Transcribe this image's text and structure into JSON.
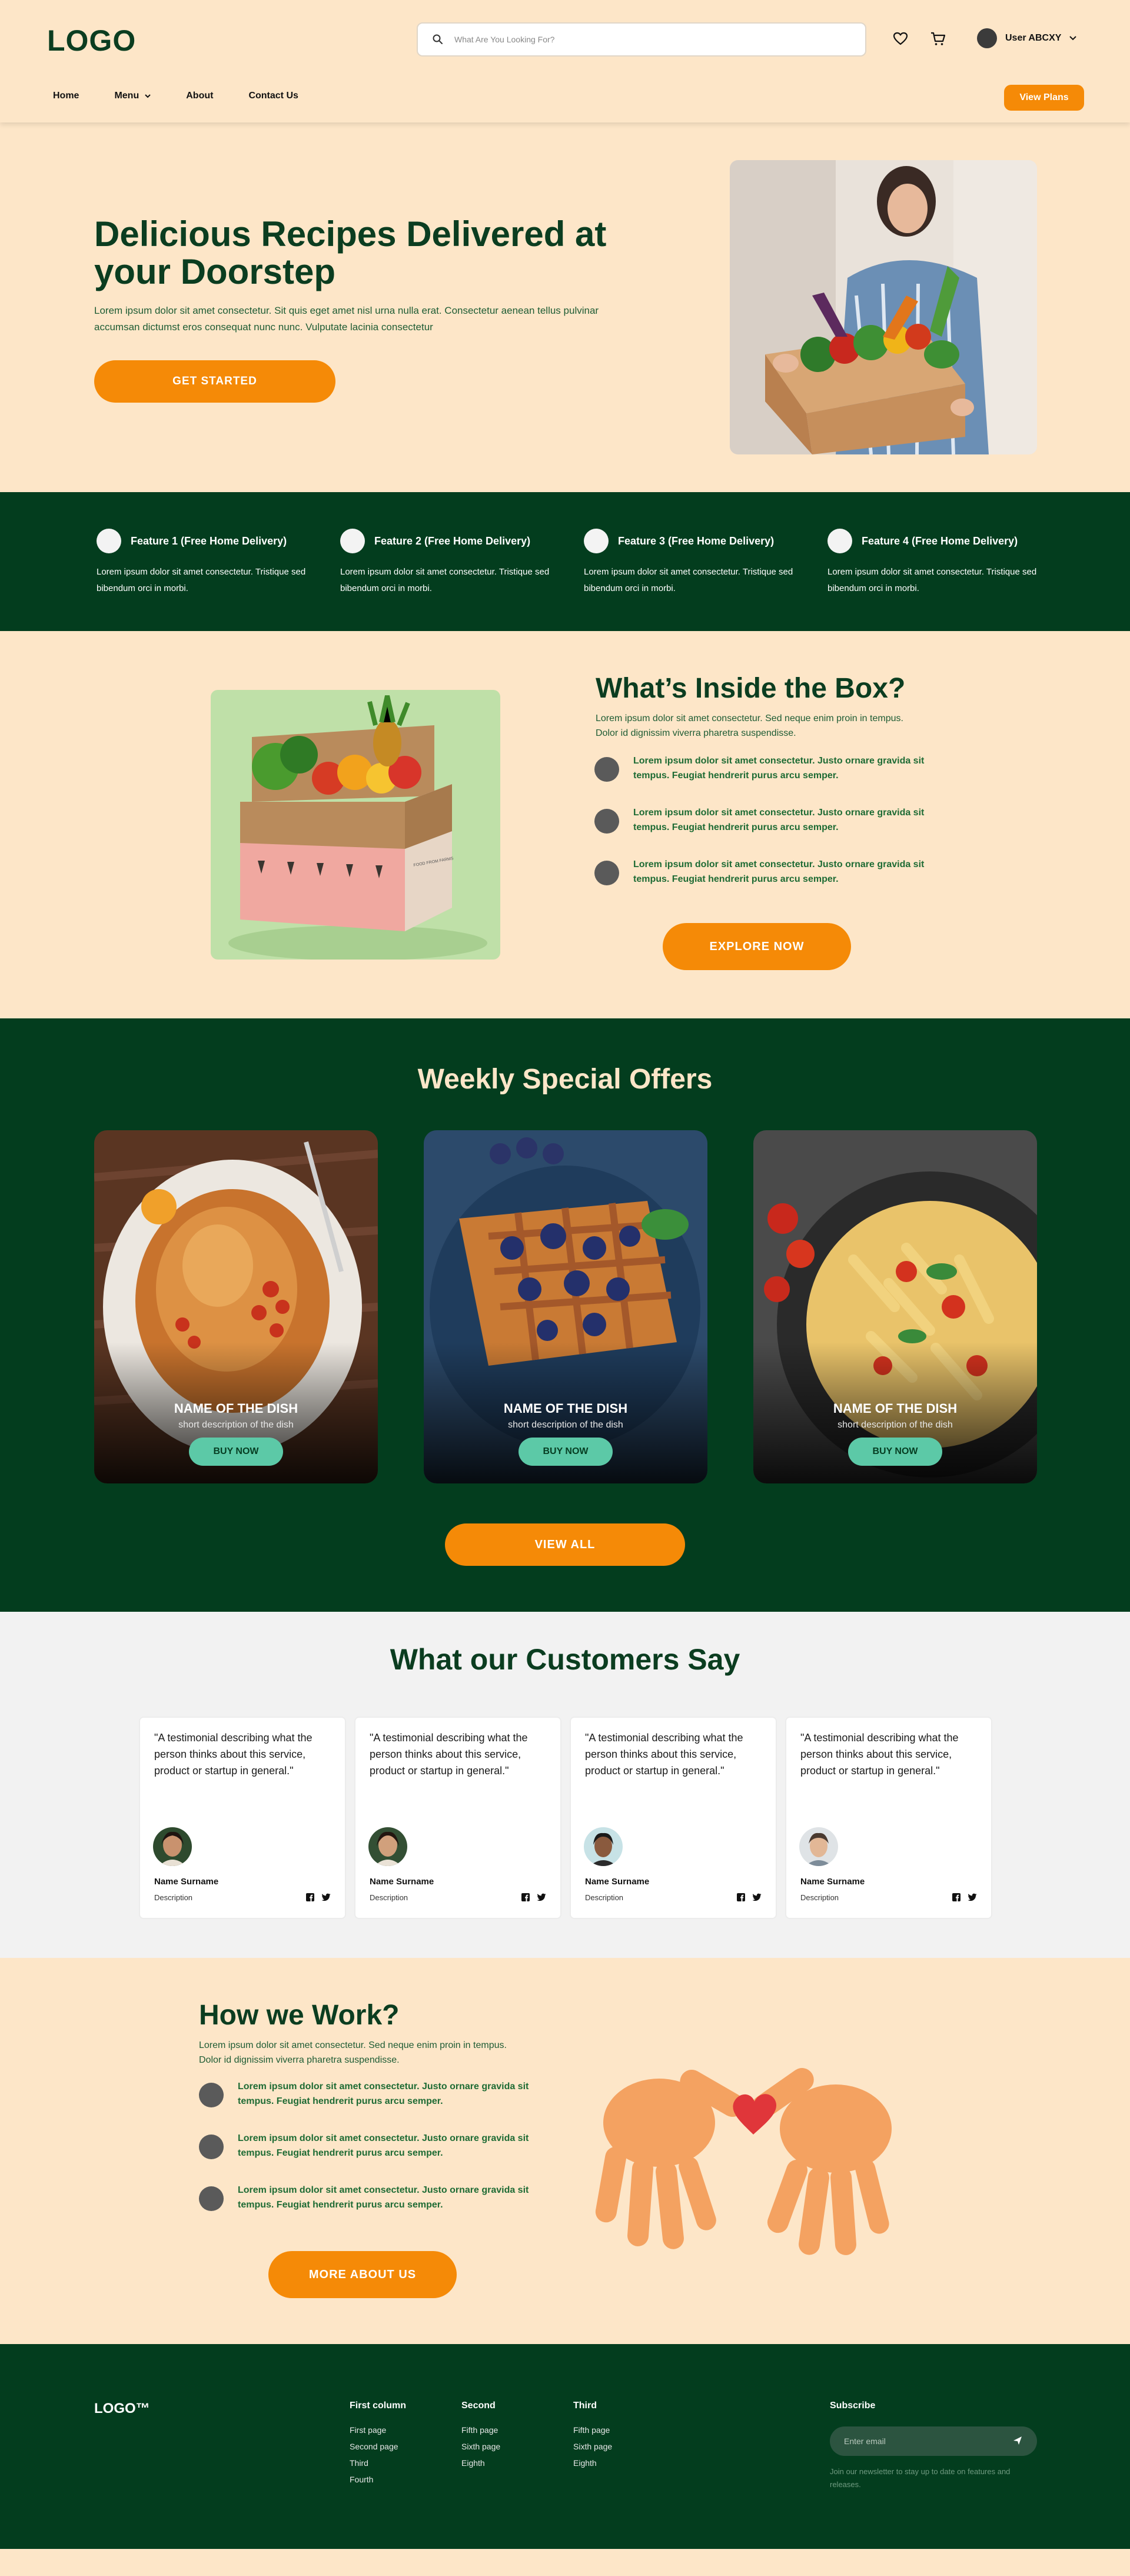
{
  "header": {
    "logo": "LOGO",
    "search_placeholder": "What Are You Looking For?",
    "user_name": "User ABCXY",
    "nav": [
      "Home",
      "Menu",
      "About",
      "Contact Us"
    ],
    "view_plans": "View Plans"
  },
  "hero": {
    "title": "Delicious Recipes Delivered at your Doorstep",
    "text": "Lorem ipsum dolor sit amet consectetur. Sit quis eget amet nisl urna nulla erat. Consectetur aenean tellus pulvinar accumsan dictumst eros consequat nunc nunc. Vulputate lacinia consectetur",
    "cta": "GET STARTED"
  },
  "features": [
    {
      "title": "Feature 1 (Free Home Delivery)",
      "text": "Lorem ipsum dolor sit amet consectetur. Tristique sed bibendum orci in morbi."
    },
    {
      "title": "Feature 2 (Free Home Delivery)",
      "text": "Lorem ipsum dolor sit amet consectetur. Tristique sed bibendum orci in morbi."
    },
    {
      "title": "Feature 3 (Free Home Delivery)",
      "text": "Lorem ipsum dolor sit amet consectetur. Tristique sed bibendum orci in morbi."
    },
    {
      "title": "Feature 4 (Free Home Delivery)",
      "text": "Lorem ipsum dolor sit amet consectetur. Tristique sed bibendum orci in morbi."
    }
  ],
  "inside": {
    "title": "What’s Inside the Box?",
    "text": "Lorem ipsum dolor sit amet consectetur. Sed neque enim proin in tempus. Dolor id dignissim viverra pharetra suspendisse.",
    "bullets": [
      "Lorem ipsum dolor sit amet consectetur. Justo ornare gravida sit tempus. Feugiat hendrerit purus arcu semper.",
      "Lorem ipsum dolor sit amet consectetur. Justo ornare gravida sit tempus. Feugiat hendrerit purus arcu semper.",
      "Lorem ipsum dolor sit amet consectetur. Justo ornare gravida sit tempus. Feugiat hendrerit purus arcu semper."
    ],
    "cta": "EXPLORE NOW",
    "box_print": "FOOD FROM FARMS"
  },
  "offers": {
    "title": "Weekly Special Offers",
    "dishes": [
      {
        "name": "NAME OF THE DISH",
        "desc": "short description of the dish",
        "button": "BUY NOW"
      },
      {
        "name": "NAME OF THE DISH",
        "desc": "short description of the dish",
        "button": "BUY NOW"
      },
      {
        "name": "NAME OF THE DISH",
        "desc": "short description of the dish",
        "button": "BUY NOW"
      }
    ],
    "cta": "VIEW ALL"
  },
  "testimonials": {
    "title": "What our Customers Say",
    "items": [
      {
        "quote": "\"A testimonial describing what the person thinks about this service, product or startup in general.\"",
        "name": "Name Surname",
        "desc": "Description"
      },
      {
        "quote": "\"A testimonial describing what the person thinks about this service, product or startup in general.\"",
        "name": "Name Surname",
        "desc": "Description"
      },
      {
        "quote": "\"A testimonial describing what the person thinks about this service, product or startup in general.\"",
        "name": "Name Surname",
        "desc": "Description"
      },
      {
        "quote": "\"A testimonial describing what the person thinks about this service, product or startup in general.\"",
        "name": "Name Surname",
        "desc": "Description"
      }
    ]
  },
  "how": {
    "title": "How we Work?",
    "text": "Lorem ipsum dolor sit amet consectetur. Sed neque enim proin in tempus. Dolor id dignissim viverra pharetra suspendisse.",
    "bullets": [
      "Lorem ipsum dolor sit amet consectetur. Justo ornare gravida sit tempus. Feugiat hendrerit purus arcu semper.",
      "Lorem ipsum dolor sit amet consectetur. Justo ornare gravida sit tempus. Feugiat hendrerit purus arcu semper.",
      "Lorem ipsum dolor sit amet consectetur. Justo ornare gravida sit tempus. Feugiat hendrerit purus arcu semper."
    ],
    "cta": "MORE ABOUT US"
  },
  "footer": {
    "logo": "LOGO™",
    "columns": [
      {
        "title": "First column",
        "links": [
          "First page",
          "Second page",
          "Third",
          "Fourth"
        ]
      },
      {
        "title": "Second",
        "links": [
          "Fifth page",
          "Sixth page",
          "Eighth"
        ]
      },
      {
        "title": "Third",
        "links": [
          "Fifth page",
          "Sixth page",
          "Eighth"
        ]
      }
    ],
    "subscribe_title": "Subscribe",
    "email_placeholder": "Enter email",
    "note": "Join our newsletter to stay up to date on features and releases."
  },
  "colors": {
    "green": "#033d1e",
    "cream": "#fde6c8",
    "orange": "#f58a07",
    "mint": "#5cc9a7"
  }
}
